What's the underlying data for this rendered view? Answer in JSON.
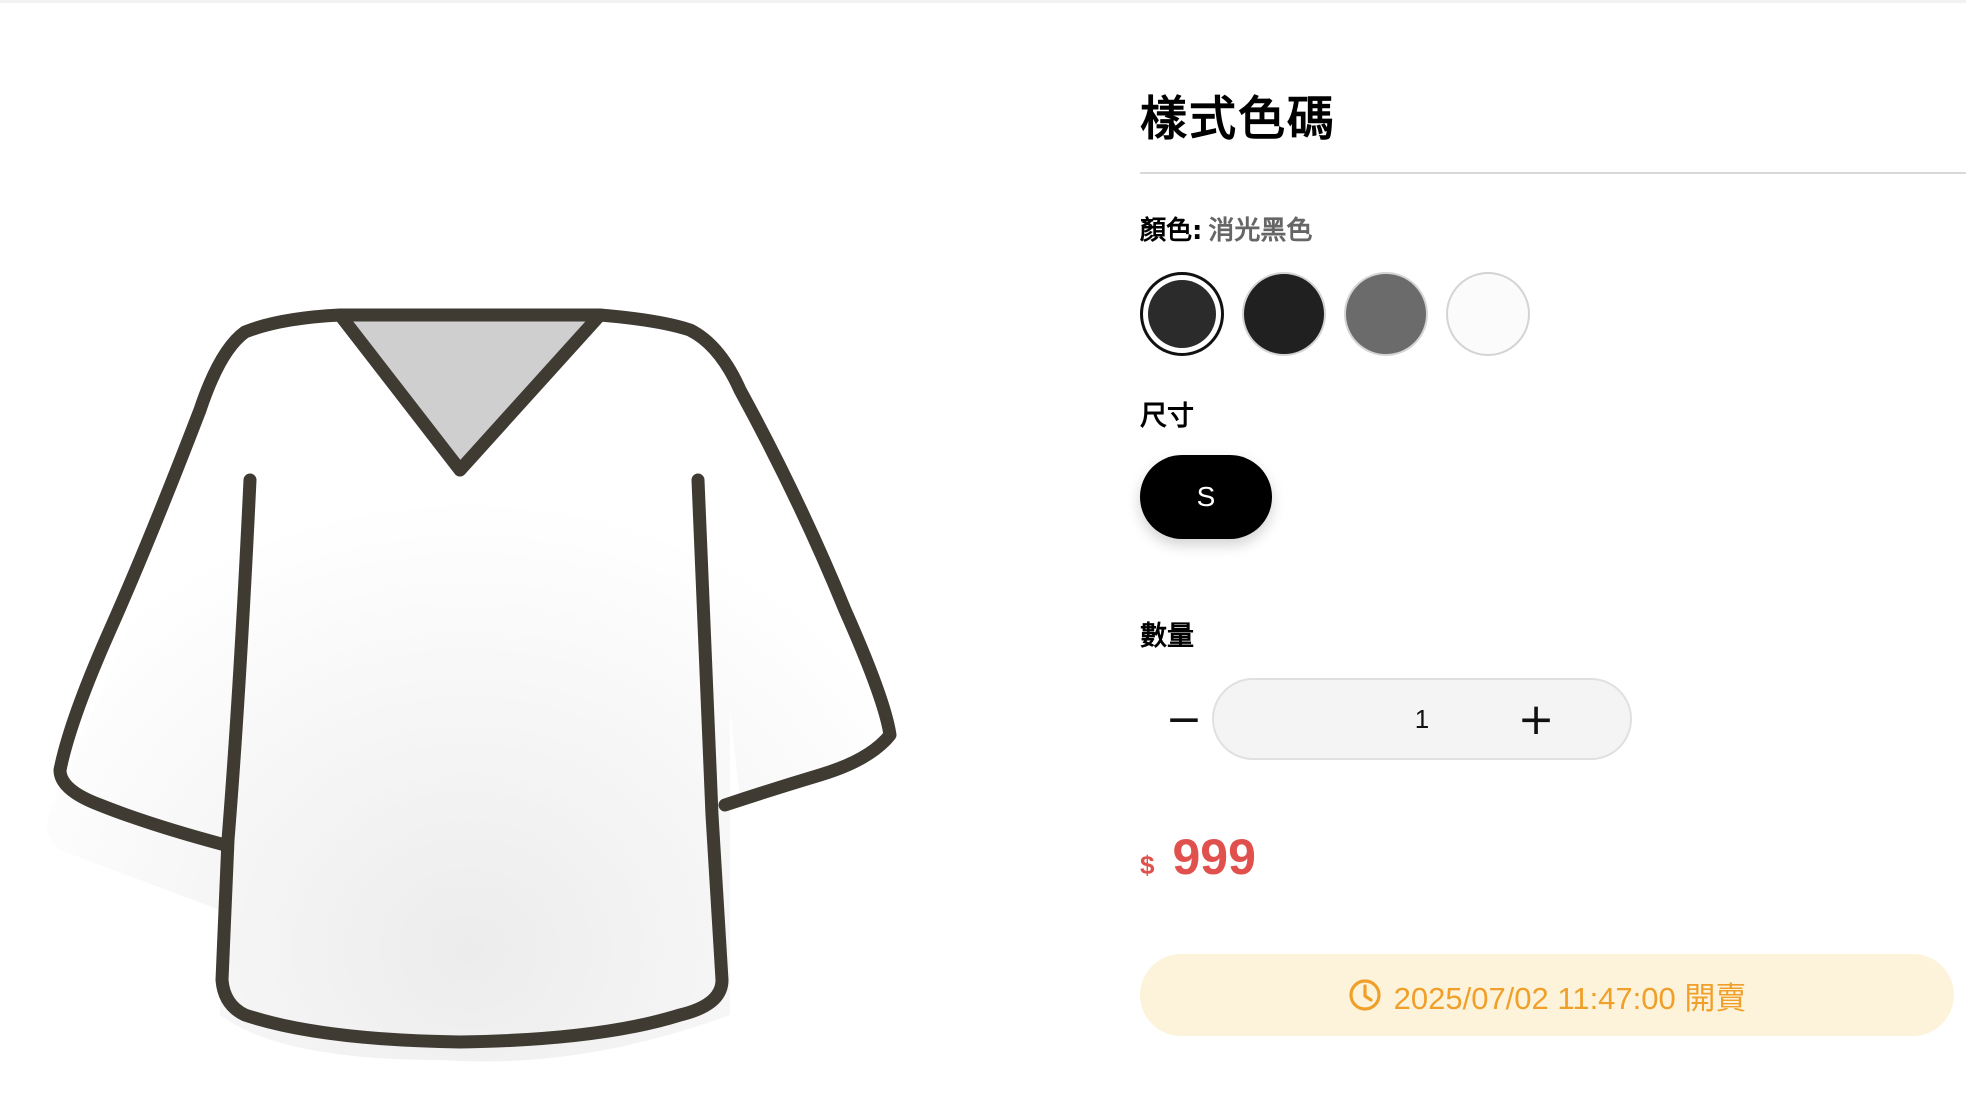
{
  "product": {
    "image_alt": "shirt-image",
    "title": "樣式色碼"
  },
  "color": {
    "label": "顏色",
    "separator": ":",
    "selected_value": "消光黑色",
    "options": [
      {
        "name": "消光黑色",
        "hex": "#2b2b2b",
        "selected": true
      },
      {
        "name": "",
        "hex": "#202020",
        "selected": false
      },
      {
        "name": "",
        "hex": "#6b6b6b",
        "selected": false
      },
      {
        "name": "",
        "hex": "#fbfbfb",
        "selected": false
      }
    ]
  },
  "size": {
    "label": "尺寸",
    "options": [
      "S"
    ],
    "selected": "S"
  },
  "quantity": {
    "label": "數量",
    "value": "1",
    "minus_symbol": "−",
    "plus_symbol": "+"
  },
  "price": {
    "currency": "$",
    "amount": "999",
    "color": "#e0514d"
  },
  "sale": {
    "icon": "clock-icon",
    "text": "2025/07/02 11:47:00 開賣",
    "color": "#f0a02a",
    "background": "#fdf3da"
  }
}
